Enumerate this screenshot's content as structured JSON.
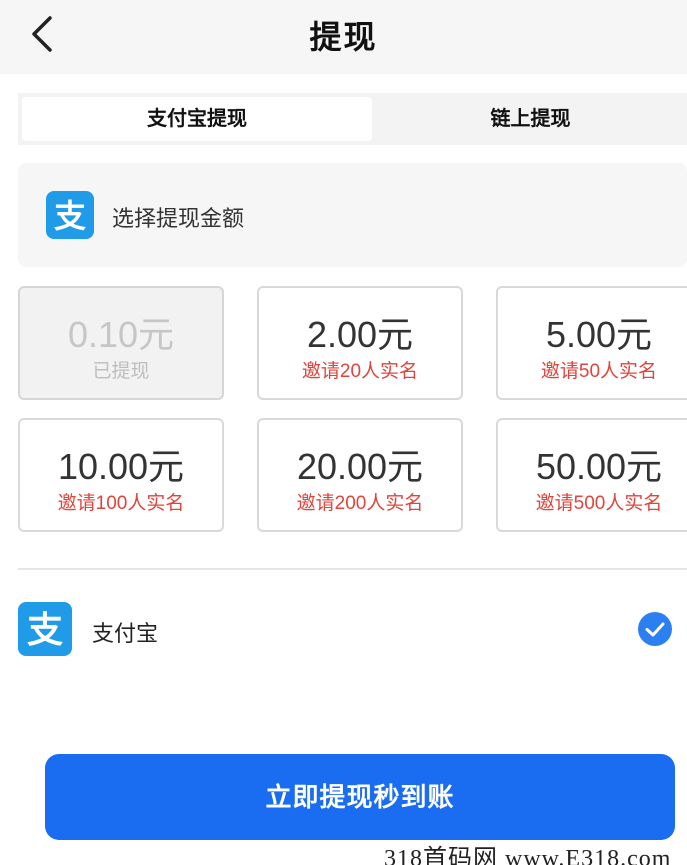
{
  "header": {
    "title": "提现",
    "back_icon": "chevron-left-icon"
  },
  "tabs": [
    {
      "label": "支付宝提现",
      "active": true
    },
    {
      "label": "链上提现",
      "active": false
    }
  ],
  "amount_section": {
    "title": "选择提现金额",
    "icon": "alipay-icon",
    "brand_color": "#1f9be8"
  },
  "options": [
    {
      "amount": "0.10元",
      "note": "已提现",
      "disabled": true
    },
    {
      "amount": "2.00元",
      "note": "邀请20人实名"
    },
    {
      "amount": "5.00元",
      "note": "邀请50人实名"
    },
    {
      "amount": "10.00元",
      "note": "邀请100人实名"
    },
    {
      "amount": "20.00元",
      "note": "邀请200人实名"
    },
    {
      "amount": "50.00元",
      "note": "邀请500人实名"
    }
  ],
  "payment_method": {
    "label": "支付宝",
    "selected": true,
    "icon": "alipay-icon",
    "check_icon": "check-circle-icon",
    "check_color": "#2c7ff2"
  },
  "submit": {
    "label": "立即提现秒到账",
    "color": "#1a6cf0"
  },
  "note_color": "#e0443c",
  "watermark": "318首码网 www.E318.com"
}
